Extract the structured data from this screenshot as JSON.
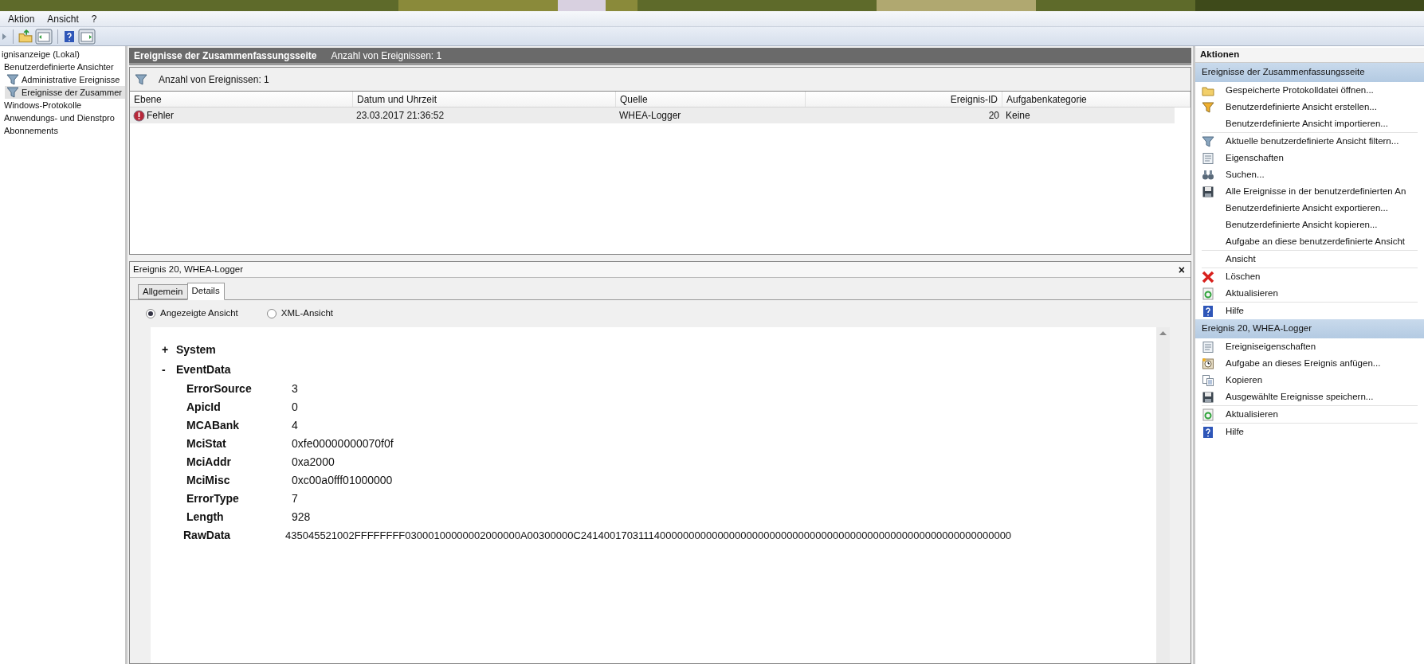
{
  "menu": [
    "Aktion",
    "Ansicht",
    "?"
  ],
  "tree": [
    {
      "label": "ignisanzeige (Lokal)",
      "selected": false,
      "children": [
        {
          "label": "Benutzerdefinierte Ansichter",
          "selected": false,
          "children": [
            {
              "label": "Administrative Ereignisse",
              "selected": false,
              "kind": "filter"
            },
            {
              "label": "Ereignisse der Zusammer",
              "selected": true,
              "kind": "filter"
            }
          ]
        },
        {
          "label": "Windows-Protokolle",
          "selected": false
        },
        {
          "label": "Anwendungs- und Dienstpro",
          "selected": false
        },
        {
          "label": "Abonnements",
          "selected": false
        }
      ]
    }
  ],
  "header": {
    "title": "Ereignisse der Zusammenfassungsseite",
    "count": "Anzahl von Ereignissen: 1"
  },
  "filter_bar": {
    "text": "Anzahl von Ereignissen: 1"
  },
  "table": {
    "columns": [
      "Ebene",
      "Datum und Uhrzeit",
      "Quelle",
      "Ereignis-ID",
      "Aufgabenkategorie"
    ],
    "rows": [
      {
        "kind": "error",
        "selected": true,
        "cells": [
          "Fehler",
          "23.03.2017 21:36:52",
          "WHEA-Logger",
          "20",
          "Keine"
        ]
      }
    ]
  },
  "details": {
    "title": "Ereignis 20, WHEA-Logger",
    "close": "×",
    "tabs": [
      {
        "label": "Allgemein",
        "selected": false
      },
      {
        "label": "Details",
        "selected": true
      }
    ],
    "views": [
      {
        "label": "Angezeigte Ansicht",
        "selected": true
      },
      {
        "label": "XML-Ansicht",
        "selected": false
      }
    ],
    "sections": [
      {
        "toggle": "+",
        "name": "System"
      },
      {
        "toggle": "-",
        "name": "EventData",
        "fields": [
          {
            "name": "ErrorSource",
            "value": "3"
          },
          {
            "name": "ApicId",
            "value": "0"
          },
          {
            "name": "MCABank",
            "value": "4"
          },
          {
            "name": "MciStat",
            "value": "0xfe00000000070f0f"
          },
          {
            "name": "MciAddr",
            "value": "0xa2000"
          },
          {
            "name": "MciMisc",
            "value": "0xc00a0fff01000000"
          },
          {
            "name": "ErrorType",
            "value": "7"
          },
          {
            "name": "Length",
            "value": "928"
          }
        ]
      }
    ],
    "raw_data": {
      "name": "RawData",
      "value": "435045521002FFFFFFFF03000100000002000000A00300000C241400170311140000000000000000000000000000000000000000000000000000000000000"
    }
  },
  "actions": {
    "title": "Aktionen",
    "sections": [
      {
        "title": "Ereignisse der Zusammenfassungsseite",
        "groups": [
          [
            {
              "label": "Gespeicherte Protokolldatei öffnen...",
              "kind": "folder"
            },
            {
              "label": "Benutzerdefinierte Ansicht erstellen...",
              "kind": "filter-new"
            },
            {
              "label": "Benutzerdefinierte Ansicht importieren..."
            }
          ],
          [
            {
              "label": "Aktuelle benutzerdefinierte Ansicht filtern...",
              "kind": "filter"
            },
            {
              "label": "Eigenschaften",
              "kind": "properties"
            },
            {
              "label": "Suchen...",
              "kind": "binoculars"
            },
            {
              "label": "Alle Ereignisse in der benutzerdefinierten An",
              "kind": "save"
            },
            {
              "label": "Benutzerdefinierte Ansicht exportieren..."
            },
            {
              "label": "Benutzerdefinierte Ansicht kopieren..."
            },
            {
              "label": "Aufgabe an diese benutzerdefinierte Ansicht"
            }
          ],
          [
            {
              "label": "Ansicht"
            }
          ],
          [
            {
              "label": "Löschen",
              "kind": "delete"
            },
            {
              "label": "Aktualisieren",
              "kind": "refresh"
            }
          ],
          [
            {
              "label": "Hilfe",
              "kind": "help"
            }
          ]
        ]
      },
      {
        "title": "Ereignis 20, WHEA-Logger",
        "groups": [
          [
            {
              "label": "Ereigniseigenschaften",
              "kind": "properties"
            },
            {
              "label": "Aufgabe an dieses Ereignis anfügen...",
              "kind": "task"
            },
            {
              "label": "Kopieren",
              "kind": "copy"
            },
            {
              "label": "Ausgewählte Ereignisse speichern...",
              "kind": "save"
            }
          ],
          [
            {
              "label": "Aktualisieren",
              "kind": "refresh"
            }
          ],
          [
            {
              "label": "Hilfe",
              "kind": "help"
            }
          ]
        ]
      }
    ]
  }
}
